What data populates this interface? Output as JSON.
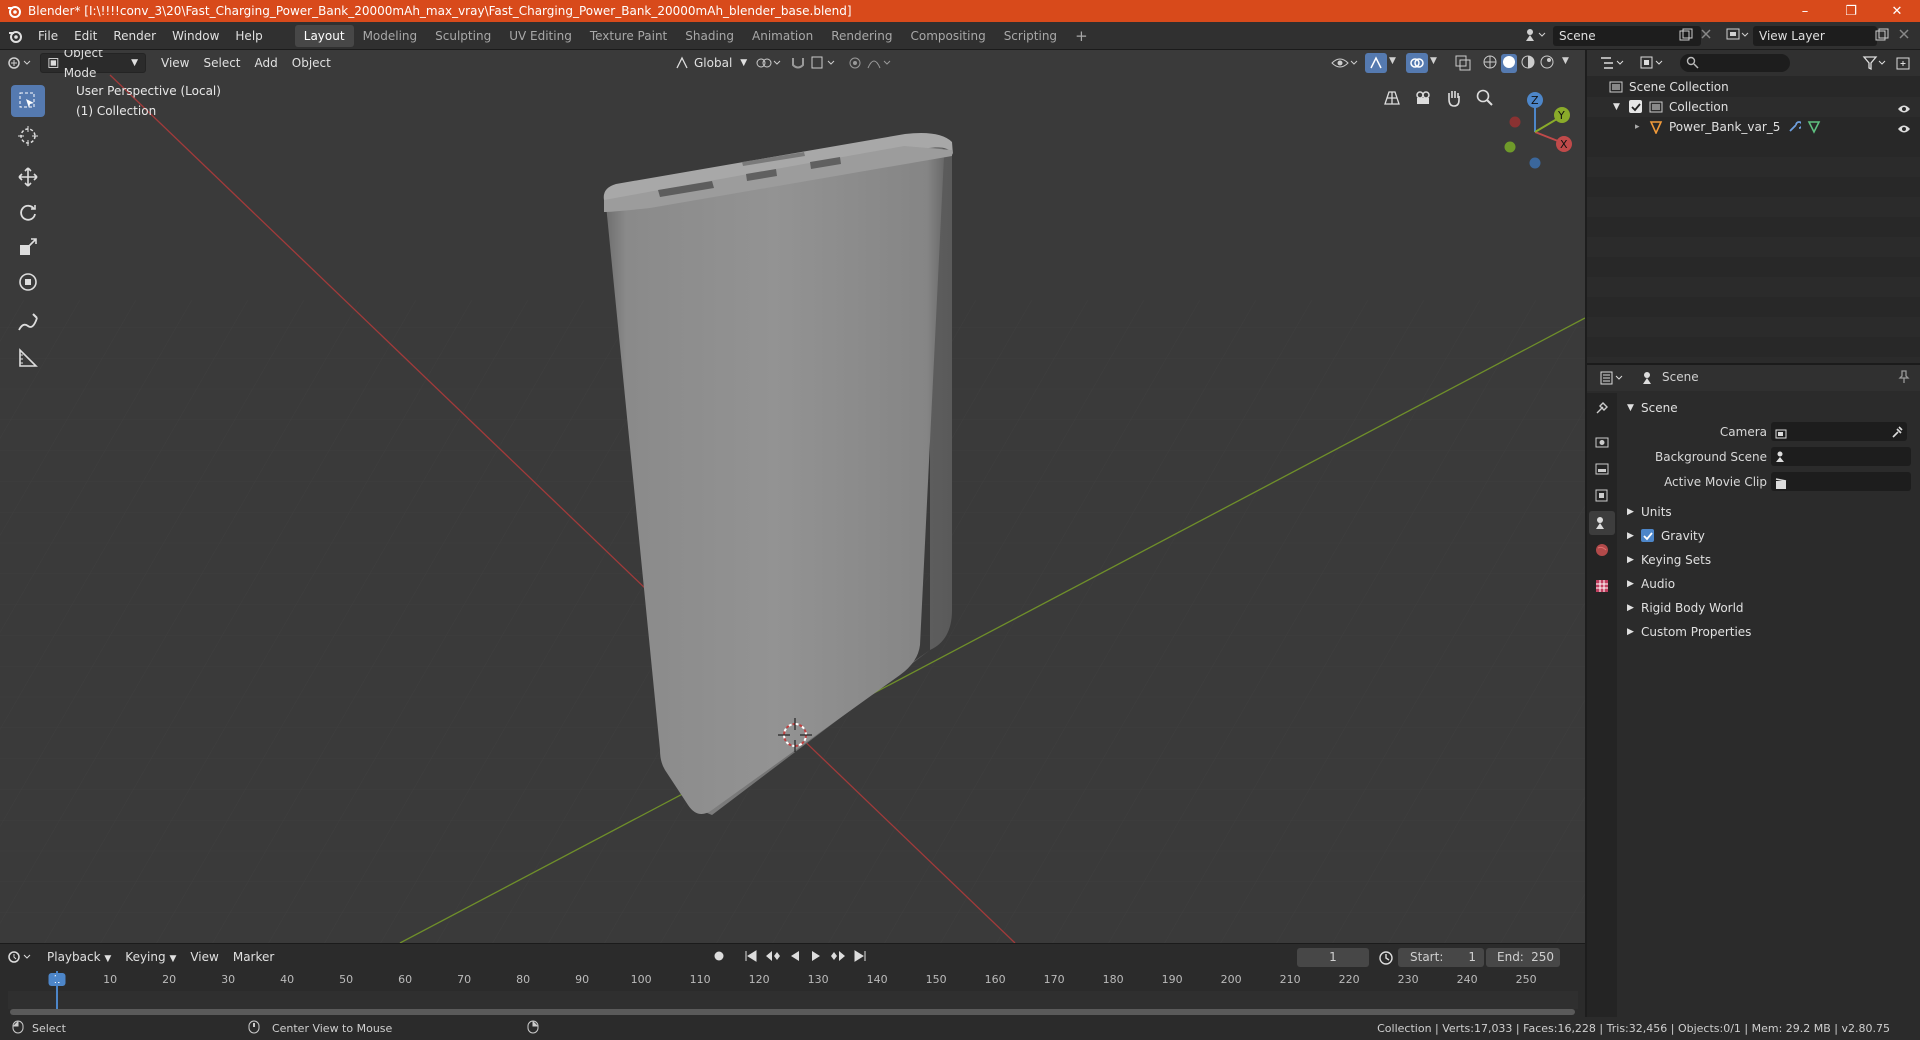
{
  "titlebar": {
    "title": "Blender* [I:\\!!!!conv_3\\20\\Fast_Charging_Power_Bank_20000mAh_max_vray\\Fast_Charging_Power_Bank_20000mAh_blender_base.blend]",
    "minimize": "–",
    "maximize": "❐",
    "close": "✕"
  },
  "menu": [
    "File",
    "Edit",
    "Render",
    "Window",
    "Help"
  ],
  "workspaces": [
    "Layout",
    "Modeling",
    "Sculpting",
    "UV Editing",
    "Texture Paint",
    "Shading",
    "Animation",
    "Rendering",
    "Compositing",
    "Scripting"
  ],
  "workspace_add": "+",
  "scene_name": "Scene",
  "view_layer": "View Layer",
  "viewport": {
    "mode": "Object Mode",
    "menus": [
      "View",
      "Select",
      "Add",
      "Object"
    ],
    "transform_orientation": "Global",
    "overlay_line1": "User Perspective (Local)",
    "overlay_line2": "(1) Collection",
    "gizmo_axes": {
      "x": "X",
      "y": "Y",
      "z": "Z"
    }
  },
  "outliner": {
    "root": "Scene Collection",
    "collection": "Collection",
    "object": "Power_Bank_var_5"
  },
  "properties": {
    "header": "Scene",
    "panel_title": "Scene",
    "fields": [
      {
        "label": "Camera"
      },
      {
        "label": "Background Scene"
      },
      {
        "label": "Active Movie Clip"
      }
    ],
    "sections": [
      "Units",
      "Gravity",
      "Keying Sets",
      "Audio",
      "Rigid Body World",
      "Custom Properties"
    ],
    "gravity_checked": true
  },
  "timeline": {
    "menus": [
      "Playback",
      "Keying",
      "View",
      "Marker"
    ],
    "current_frame": "1",
    "start_label": "Start:",
    "start": "1",
    "end_label": "End:",
    "end": "250",
    "ticks": [
      "1",
      "10",
      "20",
      "30",
      "40",
      "50",
      "60",
      "70",
      "80",
      "90",
      "100",
      "110",
      "120",
      "130",
      "140",
      "150",
      "160",
      "170",
      "180",
      "190",
      "200",
      "210",
      "220",
      "230",
      "240",
      "250"
    ]
  },
  "status": {
    "left_action": "Select",
    "middle_action": "Center View to Mouse",
    "stats": "Collection | Verts:17,033 | Faces:16,228 | Tris:32,456 | Objects:0/1 | Mem: 29.2 MB | v2.80.75"
  },
  "colors": {
    "title_bar": "#d84a1b",
    "accent_blue": "#557ab0",
    "x_axis": "#c23a3a",
    "y_axis": "#7a9a2a",
    "frame_marker": "#4d86c9"
  }
}
